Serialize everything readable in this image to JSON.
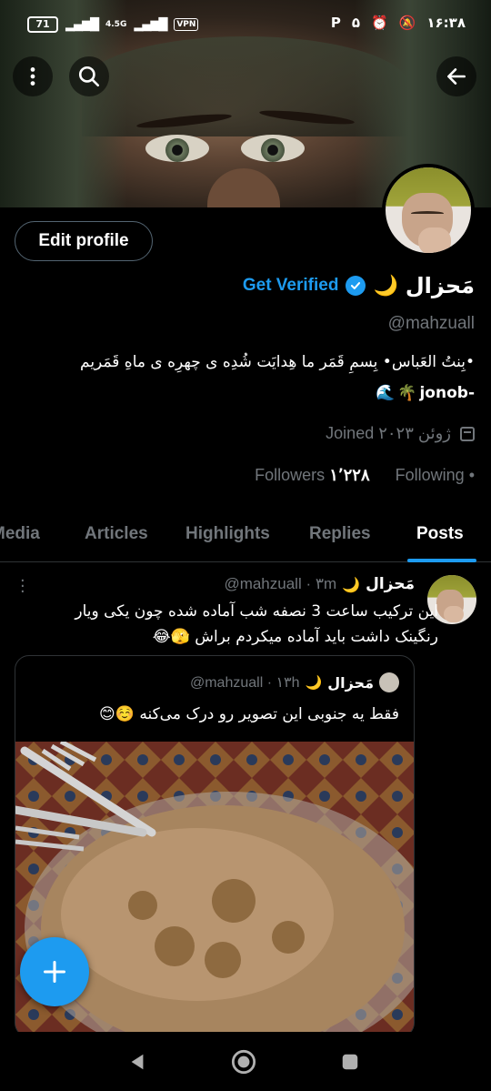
{
  "status_bar": {
    "battery": "71",
    "network": "4.5G",
    "vpn": "VPN",
    "time": "۱۶:۳۸",
    "notif_count": "۵"
  },
  "profile": {
    "display_name": "مَحزال",
    "get_verified": "Get Verified",
    "handle": "@mahzuall",
    "edit_label": "Edit profile",
    "bio_line1": "•بِنتُ العَباس• بِسمِ قَمَر ما هِدایَت شُدِه ی چهرِه ی ماهِ قَمَریم",
    "bio_line2_text": "jonob-",
    "joined": "Joined ۲۰۲۳ ژوئن",
    "followers_count": "۱٬۲۲۸",
    "followers_label": "Followers",
    "following_label": "Following",
    "following_count": "•"
  },
  "tabs": [
    {
      "label": "Media"
    },
    {
      "label": "Articles"
    },
    {
      "label": "Highlights"
    },
    {
      "label": "Replies"
    },
    {
      "label": "Posts"
    }
  ],
  "post": {
    "name": "مَحزال",
    "meta": "@mahzuall · ۳m",
    "text": "این ترکیب ساعت 3 نصفه شب آماده شده چون یکی ویار رنگینک داشت باید آماده میکردم براش 🫣😂",
    "quote": {
      "name": "مَحزال",
      "meta": "@mahzuall · ۱۳h",
      "text": "فقط یه جنوبی این تصویر رو درک می‌کنه ☺️😊"
    }
  },
  "colors": {
    "accent": "#1d9bf0",
    "muted": "#71767b",
    "background": "#000000"
  },
  "icons": [
    "back-arrow-icon",
    "search-icon",
    "more-vertical-icon",
    "verified-badge-icon",
    "calendar-icon",
    "plus-icon"
  ]
}
